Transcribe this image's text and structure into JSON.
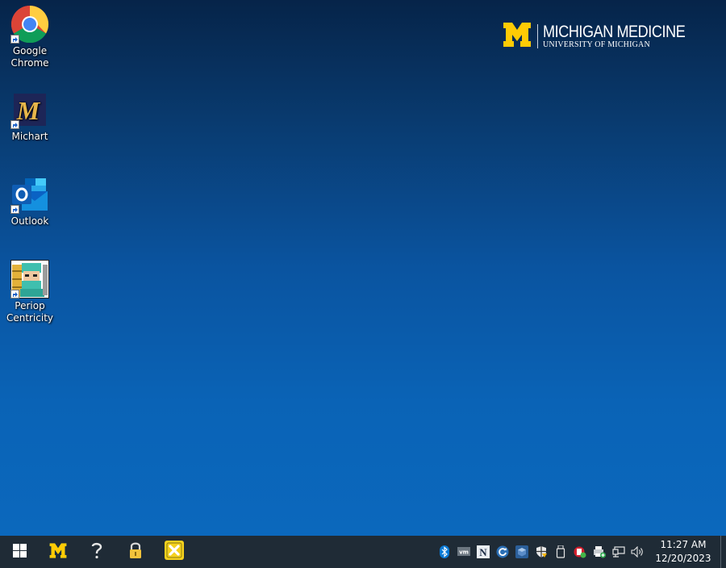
{
  "desktop": {
    "icons": [
      {
        "label": "Google Chrome",
        "icon": "chrome-icon"
      },
      {
        "label": "Michart",
        "icon": "michart-icon"
      },
      {
        "label": "Outlook",
        "icon": "outlook-icon"
      },
      {
        "label": "Periop Centricity",
        "icon": "periop-centricity-icon"
      }
    ],
    "background_top": "#062449",
    "background_bottom": "#0b68bd"
  },
  "brand": {
    "name": "MICHIGAN MEDICINE",
    "sub": "UNIVERSITY OF MICHIGAN",
    "maize": "#ffcb05"
  },
  "taskbar": {
    "pinned": [
      {
        "name": "start-button",
        "icon": "windows-icon"
      },
      {
        "name": "michigan-m-button",
        "icon": "block-m-icon"
      },
      {
        "name": "help-button",
        "icon": "question-mark-icon"
      },
      {
        "name": "lock-button",
        "icon": "padlock-icon"
      },
      {
        "name": "yellow-x-button",
        "icon": "yellow-x-icon"
      }
    ],
    "tray_icons": [
      "bluetooth-icon",
      "vmware-icon",
      "n-app-icon",
      "sync-icon",
      "cube-icon",
      "security-shield-icon",
      "usb-drive-icon",
      "red-badge-icon",
      "printer-plus-icon",
      "network-icon",
      "volume-icon"
    ],
    "clock": {
      "time": "11:27 AM",
      "date": "12/20/2023"
    }
  }
}
